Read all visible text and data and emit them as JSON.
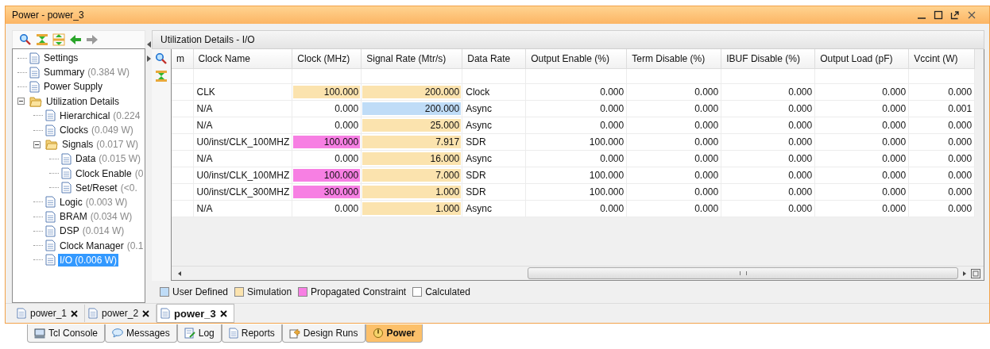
{
  "window": {
    "title": "Power - power_3"
  },
  "tree": [
    {
      "label": "Settings",
      "selected": false
    },
    {
      "label": "Summary",
      "value": "(0.384 W)",
      "selected": false
    },
    {
      "label": "Power Supply",
      "selected": false
    },
    {
      "label": "Utilization Details",
      "expanded": true,
      "selected": false,
      "children": [
        {
          "label": "Hierarchical",
          "value": "(0.224",
          "selected": false
        },
        {
          "label": "Clocks",
          "value": "(0.049 W)",
          "selected": false
        },
        {
          "label": "Signals",
          "value": "(0.017 W)",
          "expanded": true,
          "selected": false,
          "children": [
            {
              "label": "Data",
              "value": "(0.015 W)",
              "selected": false
            },
            {
              "label": "Clock Enable",
              "value": "(0",
              "selected": false
            },
            {
              "label": "Set/Reset",
              "value": "(<0.",
              "selected": false
            }
          ]
        },
        {
          "label": "Logic",
          "value": "(0.003 W)",
          "selected": false
        },
        {
          "label": "BRAM",
          "value": "(0.034 W)",
          "selected": false
        },
        {
          "label": "DSP",
          "value": "(0.014 W)",
          "selected": false
        },
        {
          "label": "Clock Manager",
          "value": "(0.1",
          "selected": false
        },
        {
          "label": "I/O (0.006 W)",
          "selected": true
        }
      ]
    }
  ],
  "panel": {
    "title": "Utilization Details - I/O"
  },
  "table": {
    "columns": [
      "m",
      "Clock Name",
      "Clock (MHz)",
      "Signal Rate (Mtr/s)",
      "Data Rate",
      "Output Enable (%)",
      "Term Disable (%)",
      "IBUF Disable (%)",
      "Output Load (pF)",
      "Vccint (W)"
    ],
    "rows": [
      {
        "clock_name": "CLK",
        "clock": {
          "value": "100.000",
          "color": "#fbe3ae"
        },
        "signal_rate": {
          "value": "200.000",
          "color": "#fbe3ae"
        },
        "data_rate": "Clock",
        "output_enable": "0.000",
        "term_disable": "0.000",
        "ibuf_disable": "0.000",
        "output_load": "0.000",
        "vccint": "0.000"
      },
      {
        "clock_name": "N/A",
        "clock": {
          "value": "0.000",
          "color": "#ffffff"
        },
        "signal_rate": {
          "value": "200.000",
          "color": "#bfdcf7"
        },
        "data_rate": "Async",
        "output_enable": "0.000",
        "term_disable": "0.000",
        "ibuf_disable": "0.000",
        "output_load": "0.000",
        "vccint": "0.001"
      },
      {
        "clock_name": "N/A",
        "clock": {
          "value": "0.000",
          "color": "#ffffff"
        },
        "signal_rate": {
          "value": "25.000",
          "color": "#fbe3ae"
        },
        "data_rate": "Async",
        "output_enable": "0.000",
        "term_disable": "0.000",
        "ibuf_disable": "0.000",
        "output_load": "0.000",
        "vccint": "0.000"
      },
      {
        "clock_name": "U0/inst/CLK_100MHZ",
        "clock": {
          "value": "100.000",
          "color": "#f77fe3"
        },
        "signal_rate": {
          "value": "7.917",
          "color": "#fbe3ae"
        },
        "data_rate": "SDR",
        "output_enable": "100.000",
        "term_disable": "0.000",
        "ibuf_disable": "0.000",
        "output_load": "0.000",
        "vccint": "0.000"
      },
      {
        "clock_name": "N/A",
        "clock": {
          "value": "0.000",
          "color": "#ffffff"
        },
        "signal_rate": {
          "value": "16.000",
          "color": "#fbe3ae"
        },
        "data_rate": "Async",
        "output_enable": "0.000",
        "term_disable": "0.000",
        "ibuf_disable": "0.000",
        "output_load": "0.000",
        "vccint": "0.000"
      },
      {
        "clock_name": "U0/inst/CLK_100MHZ",
        "clock": {
          "value": "100.000",
          "color": "#f77fe3"
        },
        "signal_rate": {
          "value": "7.000",
          "color": "#fbe3ae"
        },
        "data_rate": "SDR",
        "output_enable": "100.000",
        "term_disable": "0.000",
        "ibuf_disable": "0.000",
        "output_load": "0.000",
        "vccint": "0.000"
      },
      {
        "clock_name": "U0/inst/CLK_300MHZ",
        "clock": {
          "value": "300.000",
          "color": "#f77fe3"
        },
        "signal_rate": {
          "value": "1.000",
          "color": "#fbe3ae"
        },
        "data_rate": "SDR",
        "output_enable": "100.000",
        "term_disable": "0.000",
        "ibuf_disable": "0.000",
        "output_load": "0.000",
        "vccint": "0.000"
      },
      {
        "clock_name": "N/A",
        "clock": {
          "value": "0.000",
          "color": "#ffffff"
        },
        "signal_rate": {
          "value": "1.000",
          "color": "#fbe3ae"
        },
        "data_rate": "Async",
        "output_enable": "0.000",
        "term_disable": "0.000",
        "ibuf_disable": "0.000",
        "output_load": "0.000",
        "vccint": "0.000"
      }
    ]
  },
  "legend": [
    {
      "color": "#bfdcf7",
      "label": "User Defined"
    },
    {
      "color": "#fbe3ae",
      "label": "Simulation"
    },
    {
      "color": "#f77fe3",
      "label": "Propagated Constraint"
    },
    {
      "color": "#ffffff",
      "label": "Calculated"
    }
  ],
  "document_tabs": [
    {
      "label": "power_1",
      "selected": false
    },
    {
      "label": "power_2",
      "selected": false
    },
    {
      "label": "power_3",
      "selected": true
    }
  ],
  "tool_tabs": [
    {
      "kind": "console",
      "label": "Tcl Console",
      "selected": false
    },
    {
      "kind": "messages",
      "label": "Messages",
      "selected": false
    },
    {
      "kind": "log",
      "label": "Log",
      "selected": false
    },
    {
      "kind": "reports",
      "label": "Reports",
      "selected": false
    },
    {
      "kind": "runs",
      "label": "Design Runs",
      "selected": false
    },
    {
      "kind": "power",
      "label": "Power",
      "selected": true
    }
  ]
}
